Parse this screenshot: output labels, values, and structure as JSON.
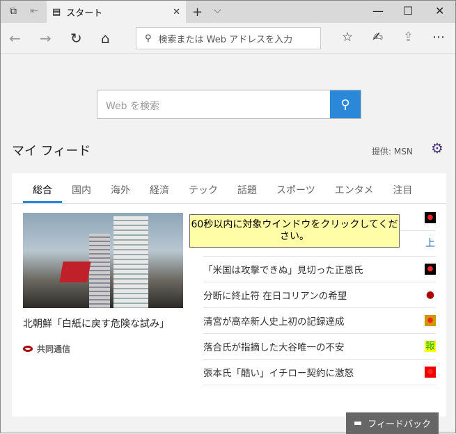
{
  "tab": {
    "title": "スタート"
  },
  "address": {
    "placeholder": "検索または Web アドレスを入力"
  },
  "search": {
    "placeholder": "Web を検索"
  },
  "feed": {
    "heading": "マイ フィード",
    "provider": "提供: MSN",
    "tabs": [
      "総合",
      "国内",
      "海外",
      "経済",
      "テック",
      "話題",
      "スポーツ",
      "エンタメ",
      "注目"
    ],
    "lead": {
      "title": "北朝鮮「白紙に戻す危険な試み」",
      "source": "共同通信"
    },
    "items": [
      {
        "title": "",
        "icon": "tv-logo",
        "color": "#000"
      },
      {
        "title": "",
        "icon": "上",
        "color": "#1a5fb4"
      },
      {
        "title": "「米国は攻撃できぬ」見切った正恩氏",
        "icon": "tv-logo",
        "color": "#000"
      },
      {
        "title": "分断に終止符 在日コリアンの希望",
        "icon": "kyodo-logo",
        "color": "#a00"
      },
      {
        "title": "清宮が高卒新人史上初の記録達成",
        "icon": "sports-logo",
        "color": "#c90"
      },
      {
        "title": "落合氏が指摘した大谷唯一の不安",
        "icon": "報",
        "color": "#2a2"
      },
      {
        "title": "張本氏「酷い」イチロー契約に激怒",
        "icon": "tv-red-logo",
        "color": "#e00"
      }
    ]
  },
  "tooltip": "60秒以内に対象ウインドウをクリックしてください。",
  "feedback": "フィードバック"
}
